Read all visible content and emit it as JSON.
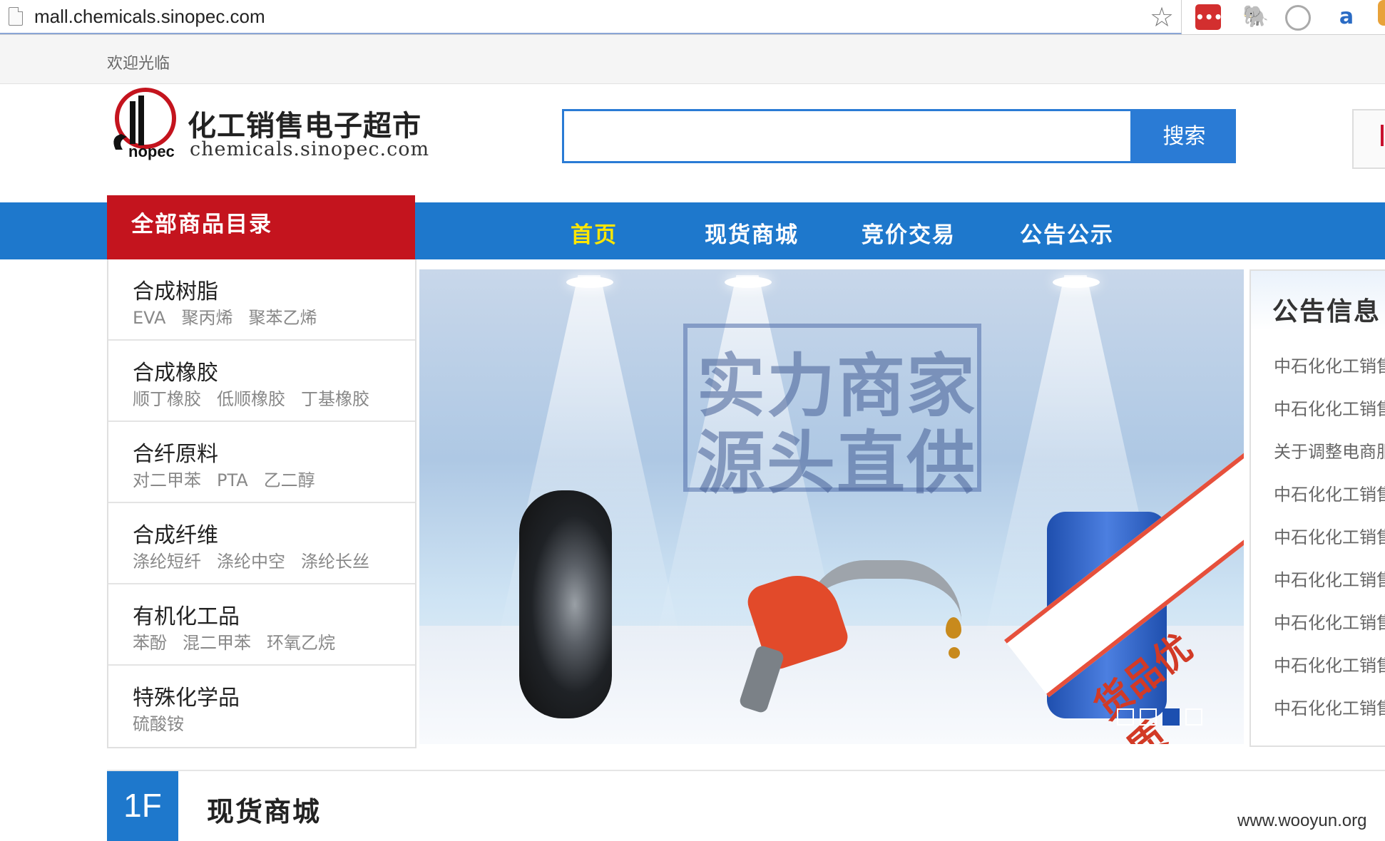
{
  "browser": {
    "url": "mall.chemicals.sinopec.com",
    "extensions": [
      "lastpass-icon",
      "evernote-icon",
      "sync-icon",
      "amazon-icon"
    ],
    "lastpass_label": "•••"
  },
  "topbar": {
    "welcome": "欢迎光临"
  },
  "header": {
    "logo_title": "化工销售电子超市",
    "logo_sub": "chemicals.sinopec.com",
    "search_placeholder": "",
    "search_button": "搜索",
    "brand_red": "#c4141e",
    "brand_blue": "#1e78cc"
  },
  "nav": {
    "category_head": "全部商品目录",
    "items": [
      {
        "label": "首页",
        "active": true
      },
      {
        "label": "现货商城"
      },
      {
        "label": "竞价交易"
      },
      {
        "label": "公告公示"
      }
    ]
  },
  "categories": [
    {
      "name": "合成树脂",
      "subs": [
        "EVA",
        "聚丙烯",
        "聚苯乙烯"
      ]
    },
    {
      "name": "合成橡胶",
      "subs": [
        "顺丁橡胶",
        "低顺橡胶",
        "丁基橡胶"
      ]
    },
    {
      "name": "合纤原料",
      "subs": [
        "对二甲苯",
        "PTA",
        "乙二醇"
      ]
    },
    {
      "name": "合成纤维",
      "subs": [
        "涤纶短纤",
        "涤纶中空",
        "涤纶长丝"
      ]
    },
    {
      "name": "有机化工品",
      "subs": [
        "苯酚",
        "混二甲苯",
        "环氧乙烷"
      ]
    },
    {
      "name": "特殊化学品",
      "subs": [
        "硫酸铵"
      ]
    }
  ],
  "banner": {
    "slogan_1": "实力商家",
    "slogan_2": "源头直供",
    "ribbon": "货品优质",
    "slide_count": 4,
    "active_slide": 3
  },
  "notice": {
    "title": "公告信息",
    "items": [
      "中石化化工销售",
      "中石化化工销售",
      "关于调整电商服",
      "中石化化工销售",
      "中石化化工销售",
      "中石化化工销售",
      "中石化化工销售",
      "中石化化工销售",
      "中石化化工销售"
    ]
  },
  "floor": {
    "badge": "1F",
    "title": "现货商城"
  },
  "watermark": "www.wooyun.org"
}
